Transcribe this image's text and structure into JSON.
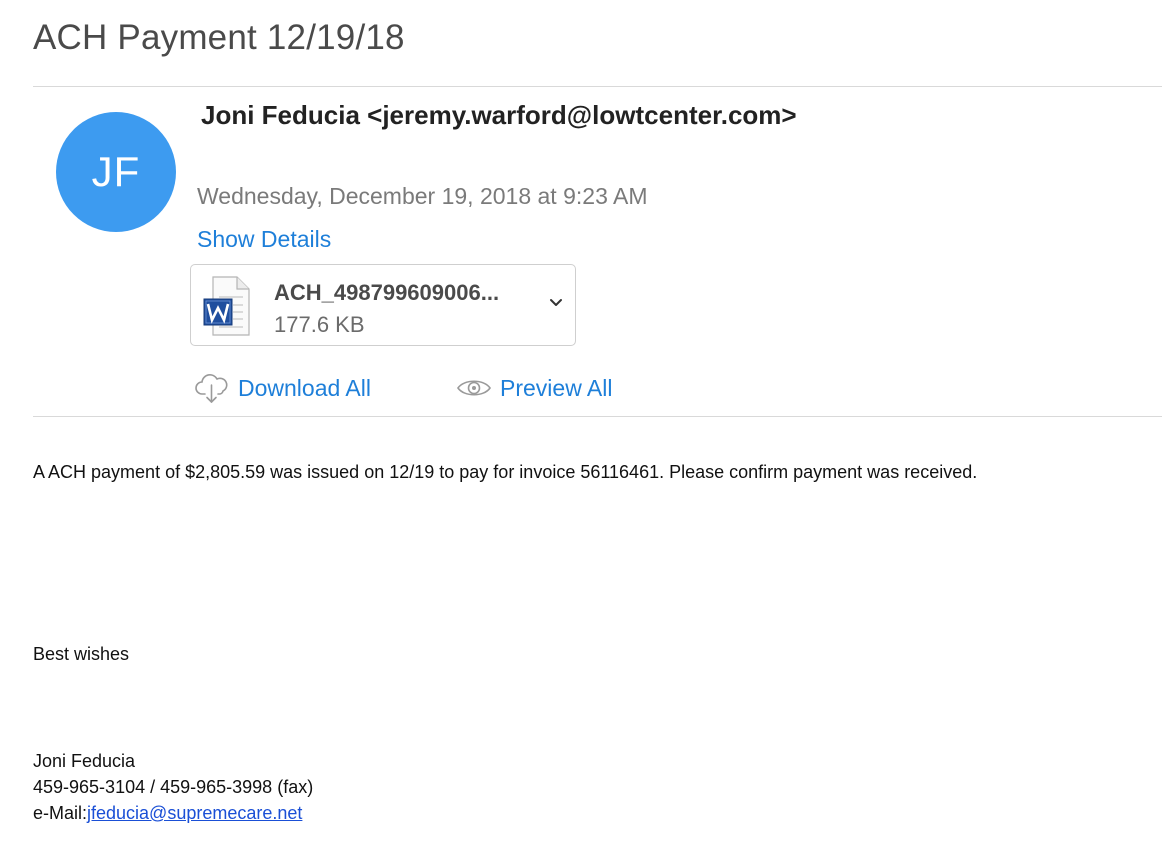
{
  "message": {
    "subject": "ACH Payment 12/19/18",
    "sender_initials": "JF",
    "from": "Joni Feducia <jeremy.warford@lowtcenter.com>",
    "date": "Wednesday, December 19, 2018 at 9:23 AM",
    "show_details_label": "Show Details"
  },
  "attachment": {
    "name": "ACH_498799609006...",
    "size": "177.6 KB",
    "icon": "word-document-icon"
  },
  "actions": {
    "download_all_label": "Download All",
    "preview_all_label": "Preview All"
  },
  "body": {
    "paragraph_1": "A ACH payment of $2,805.59 was issued on 12/19 to pay for invoice 56116461. Please confirm payment was received.",
    "closing": "Best wishes",
    "signature_name": "Joni Feducia",
    "signature_phone": "459-965-3104 / 459-965-3998  (fax)",
    "signature_email_prefix": "e-Mail:",
    "signature_email": "jfeducia@supremecare.net"
  },
  "colors": {
    "avatar": "#3d9bf0",
    "link": "#1e7fd9",
    "email_link": "#1a4fd6"
  }
}
